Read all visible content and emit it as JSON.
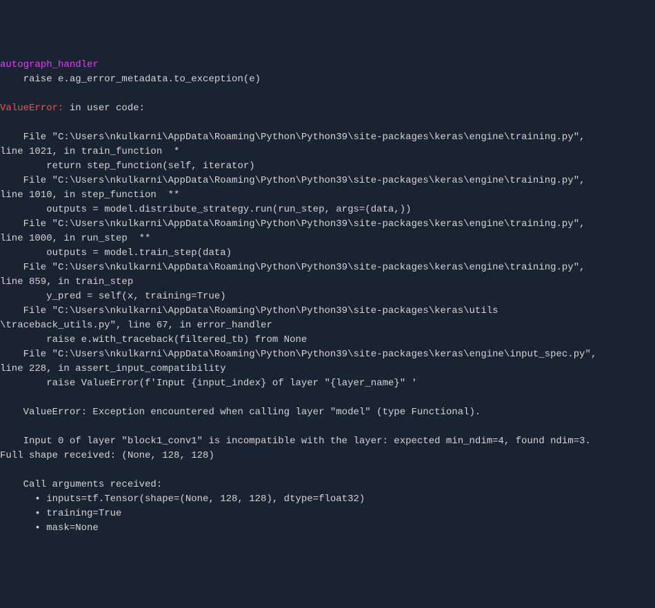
{
  "header": {
    "autographHandler": "autograph_handler",
    "raiseLine": "    raise e.ag_error_metadata.to_exception(e)"
  },
  "error": {
    "label": "ValueError:",
    "intro": " in user code:"
  },
  "traceback": {
    "lines": [
      "",
      "    File \"C:\\Users\\nkulkarni\\AppData\\Roaming\\Python\\Python39\\site-packages\\keras\\engine\\training.py\", ",
      "line 1021, in train_function  *",
      "        return step_function(self, iterator)",
      "    File \"C:\\Users\\nkulkarni\\AppData\\Roaming\\Python\\Python39\\site-packages\\keras\\engine\\training.py\", ",
      "line 1010, in step_function  **",
      "        outputs = model.distribute_strategy.run(run_step, args=(data,))",
      "    File \"C:\\Users\\nkulkarni\\AppData\\Roaming\\Python\\Python39\\site-packages\\keras\\engine\\training.py\", ",
      "line 1000, in run_step  **",
      "        outputs = model.train_step(data)",
      "    File \"C:\\Users\\nkulkarni\\AppData\\Roaming\\Python\\Python39\\site-packages\\keras\\engine\\training.py\", ",
      "line 859, in train_step",
      "        y_pred = self(x, training=True)",
      "    File \"C:\\Users\\nkulkarni\\AppData\\Roaming\\Python\\Python39\\site-packages\\keras\\utils",
      "\\traceback_utils.py\", line 67, in error_handler",
      "        raise e.with_traceback(filtered_tb) from None",
      "    File \"C:\\Users\\nkulkarni\\AppData\\Roaming\\Python\\Python39\\site-packages\\keras\\engine\\input_spec.py\",",
      "line 228, in assert_input_compatibility",
      "        raise ValueError(f'Input {input_index} of layer \"{layer_name}\" '",
      "",
      "    ValueError: Exception encountered when calling layer \"model\" (type Functional).",
      "    ",
      "    Input 0 of layer \"block1_conv1\" is incompatible with the layer: expected min_ndim=4, found ndim=3. ",
      "Full shape received: (None, 128, 128)",
      "    ",
      "    Call arguments received:",
      "      • inputs=tf.Tensor(shape=(None, 128, 128), dtype=float32)",
      "      • training=True",
      "      • mask=None"
    ]
  }
}
